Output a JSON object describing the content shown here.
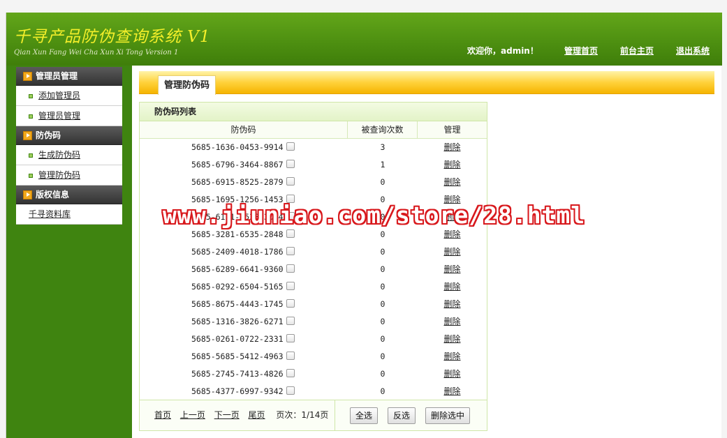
{
  "header": {
    "title": "千寻产品防伪查询系统 V1",
    "subtitle": "Qian Xun Fang Wei Cha Xun Xi Tong Version 1",
    "welcome": "欢迎你，admin！",
    "links": [
      "管理首页",
      "前台主页",
      "退出系统"
    ]
  },
  "sidebar": {
    "groups": [
      {
        "label": "管理员管理",
        "items": [
          "添加管理员",
          "管理员管理"
        ]
      },
      {
        "label": "防伪码",
        "items": [
          "生成防伪码",
          "管理防伪码"
        ]
      },
      {
        "label": "版权信息",
        "links": [
          "千寻资料库"
        ]
      }
    ]
  },
  "tab": {
    "label": "管理防伪码"
  },
  "panel": {
    "title": "防伪码列表",
    "columns": [
      "防伪码",
      "被查询次数",
      "管理"
    ],
    "delete_label": "删除",
    "rows": [
      {
        "code": "5685-1636-0453-9914",
        "count": "3"
      },
      {
        "code": "5685-6796-3464-8867",
        "count": "1"
      },
      {
        "code": "5685-6915-8525-2879",
        "count": "0"
      },
      {
        "code": "5685-1695-1256-1453",
        "count": "0"
      },
      {
        "code": "5685-6121-3533-3084",
        "count": "0"
      },
      {
        "code": "5685-3281-6535-2848",
        "count": "0"
      },
      {
        "code": "5685-2409-4018-1786",
        "count": "0"
      },
      {
        "code": "5685-6289-6641-9360",
        "count": "0"
      },
      {
        "code": "5685-0292-6504-5165",
        "count": "0"
      },
      {
        "code": "5685-8675-4443-1745",
        "count": "0"
      },
      {
        "code": "5685-1316-3826-6271",
        "count": "0"
      },
      {
        "code": "5685-0261-0722-2331",
        "count": "0"
      },
      {
        "code": "5685-5685-5412-4963",
        "count": "0"
      },
      {
        "code": "5685-2745-7413-4826",
        "count": "0"
      },
      {
        "code": "5685-4377-6997-9342",
        "count": "0"
      }
    ]
  },
  "pager": {
    "first": "首页",
    "prev": "上一页",
    "next": "下一页",
    "last": "尾页",
    "page_info": "页次：1/14页"
  },
  "buttons": {
    "select_all": "全选",
    "invert": "反选",
    "delete_selected": "删除选中"
  },
  "watermark": "www.jiuniao.com/store/28.html",
  "colors": {
    "header_green": "#4c8e10",
    "sidebar_green": "#3f8410",
    "title_yellow": "#f4ef2a",
    "tab_yellow": "#ffd23c",
    "watermark_red": "#d8181c"
  }
}
